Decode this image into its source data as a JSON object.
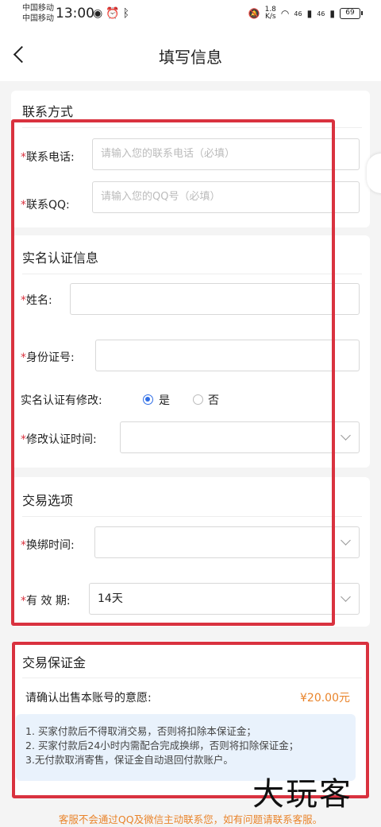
{
  "status_bar": {
    "carrier_1": "中国移动",
    "carrier_2": "中国移动",
    "time": "13:00",
    "net_speed": "1.8\nK/s",
    "network": "46",
    "battery": "69"
  },
  "nav": {
    "title": "填写信息"
  },
  "contact": {
    "title": "联系方式",
    "phone_label": "联系电话:",
    "phone_placeholder": "请输入您的联系电话（必填）",
    "qq_label": "联系QQ:",
    "qq_placeholder": "请输入您的QQ号（必填）"
  },
  "realname": {
    "title": "实名认证信息",
    "name_label": "姓名:",
    "id_label": "身份证号:",
    "modified_label": "实名认证有修改:",
    "option_yes": "是",
    "option_no": "否",
    "modify_time_label": "修改认证时间:"
  },
  "trade": {
    "title": "交易选项",
    "rebind_label": "换绑时间:",
    "validity_label": "有 效 期:",
    "validity_value": "14天"
  },
  "deposit": {
    "title": "交易保证金",
    "confirm_text": "请确认出售本账号的意愿:",
    "amount": "¥20.00元",
    "notes": [
      "1. 买家付款后不得取消交易，否则将扣除本保证金；",
      "2. 买家付款后24小时内需配合完成换绑，否则将扣除保证金；",
      "3.无付款取消寄售，保证金自动退回付款账户。"
    ]
  },
  "watermark": "大玩客",
  "footer": "客服不会通过QQ及微信主动联系您，如有问题请联系客服。",
  "colors": {
    "required": "#d9323f",
    "accent_orange": "#e9842b",
    "radio_blue": "#2f6ee6",
    "highlight_box": "#d9323f"
  }
}
